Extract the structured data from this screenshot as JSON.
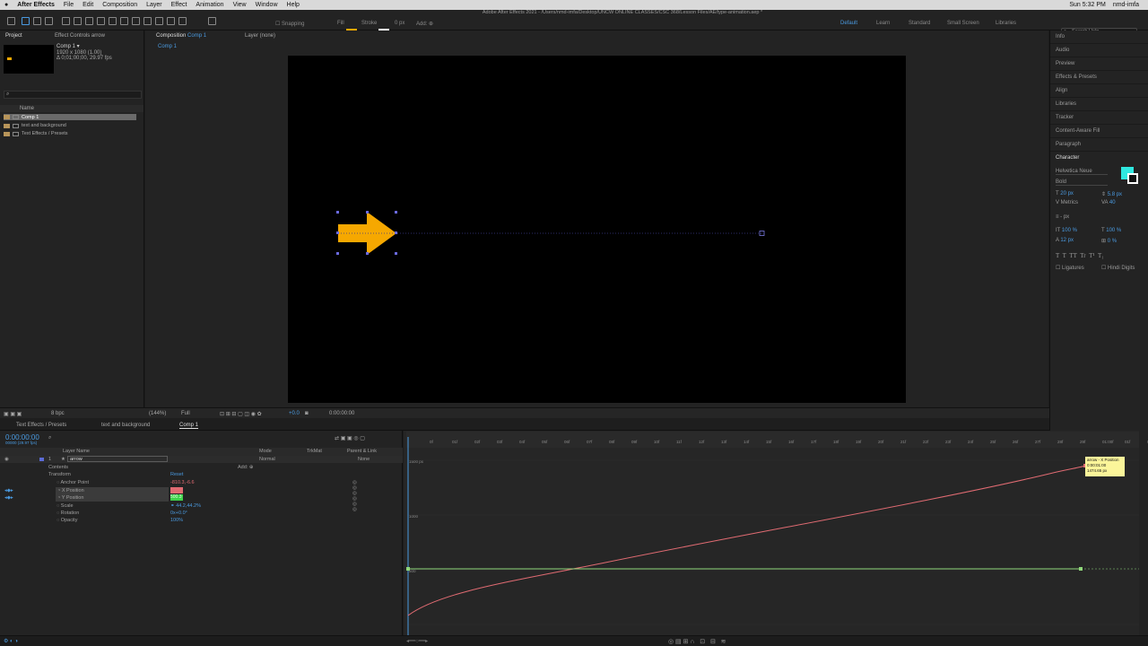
{
  "menubar": {
    "app": "After Effects",
    "items": [
      "File",
      "Edit",
      "Composition",
      "Layer",
      "Effect",
      "Animation",
      "View",
      "Window",
      "Help"
    ],
    "clock": "Sun 5:32 PM",
    "user": "nmd-imfa"
  },
  "toolbar": {
    "snapping": "Snapping",
    "fill": "Fill",
    "stroke": "Stroke",
    "stroke_px": "0 px",
    "add": "Add:",
    "title": "Adobe After Effects 2021 - /Users/nmd-imfa/Desktop/UNCW ONLINE CLASSES/CSC 368/Lesson Files/AE/type-animation.aep *",
    "workspaces": [
      "Default",
      "Learn",
      "Standard",
      "Small Screen",
      "Libraries"
    ],
    "search": "Search Help",
    "fill_color": "#f6a800"
  },
  "project": {
    "tab_project": "Project",
    "tab_effects": "Effect Controls arrow",
    "comp_name": "Comp 1 ▾",
    "comp_info1": "1920 x 1080 (1.00)",
    "comp_info2": "Δ 0;01;00;00, 29.97 fps",
    "name_col": "Name",
    "items": [
      "Comp 1",
      "text and background",
      "Text Effects / Presets"
    ],
    "bpc": "8 bpc"
  },
  "composition": {
    "tab": "Composition",
    "tab_comp": "Comp 1",
    "layer_tab": "Layer (none)",
    "breadcrumb": "Comp 1",
    "zoom": "(144%)",
    "resolution": "Full",
    "exposure": "+0.0",
    "timecode": "0:00:00:00"
  },
  "right_panel": {
    "items": [
      "Info",
      "Audio",
      "Preview",
      "Effects & Presets",
      "Align",
      "Libraries",
      "Tracker",
      "Content-Aware Fill",
      "Paragraph"
    ],
    "character": "Character",
    "font": "Helvetica Neue",
    "style": "Bold",
    "font_size": "20 px",
    "leading": "5.8 px",
    "kerning": "Metrics",
    "tracking": "40",
    "stroke_width": "- px",
    "vscale": "100 %",
    "hscale": "100 %",
    "baseline": "12 px",
    "tsume": "0 %",
    "ligatures": "Ligatures",
    "hindi": "Hindi Digits",
    "accent": "#2fe8e0"
  },
  "timeline": {
    "tabs": [
      "Text Effects / Presets",
      "text and background",
      "Comp 1"
    ],
    "time": "0:00:00:00",
    "frames": "00000 (29.97 fps)",
    "layer_name_col": "Layer Name",
    "mode_col": "Mode",
    "trkmat_col": "TrkMat",
    "parent_col": "Parent & Link",
    "layer_num": "1",
    "layer_name": "arrow",
    "mode": "Normal",
    "parent": "None",
    "contents": "Contents",
    "add": "Add:",
    "transform": "Transform",
    "reset": "Reset",
    "props": [
      {
        "name": "Anchor Point",
        "value": "-810.3,-6.6"
      },
      {
        "name": "X Position",
        "value": "310.6"
      },
      {
        "name": "Y Position",
        "value": "500.3"
      },
      {
        "name": "Scale",
        "value": "44.2,44.2%"
      },
      {
        "name": "Rotation",
        "value": "0x+0.0°"
      },
      {
        "name": "Opacity",
        "value": "100%"
      }
    ]
  },
  "graph": {
    "label_top": "1500 px",
    "label_mid": "1000",
    "label_low": "500",
    "ruler": [
      "0f",
      "01f",
      "02f",
      "03f",
      "04f",
      "05f",
      "06f",
      "07f",
      "08f",
      "09f",
      "10f",
      "11f",
      "12f",
      "13f",
      "14f",
      "15f",
      "16f",
      "17f",
      "18f",
      "19f",
      "20f",
      "21f",
      "22f",
      "23f",
      "24f",
      "25f",
      "26f",
      "27f",
      "28f",
      "29f",
      "01:00f",
      "01f",
      "02f"
    ],
    "tooltip": [
      "arrow - X Position",
      "0:00:01:00",
      "1474.65 px"
    ],
    "x_color": "#e06b72",
    "y_color": "#8fd77a"
  }
}
